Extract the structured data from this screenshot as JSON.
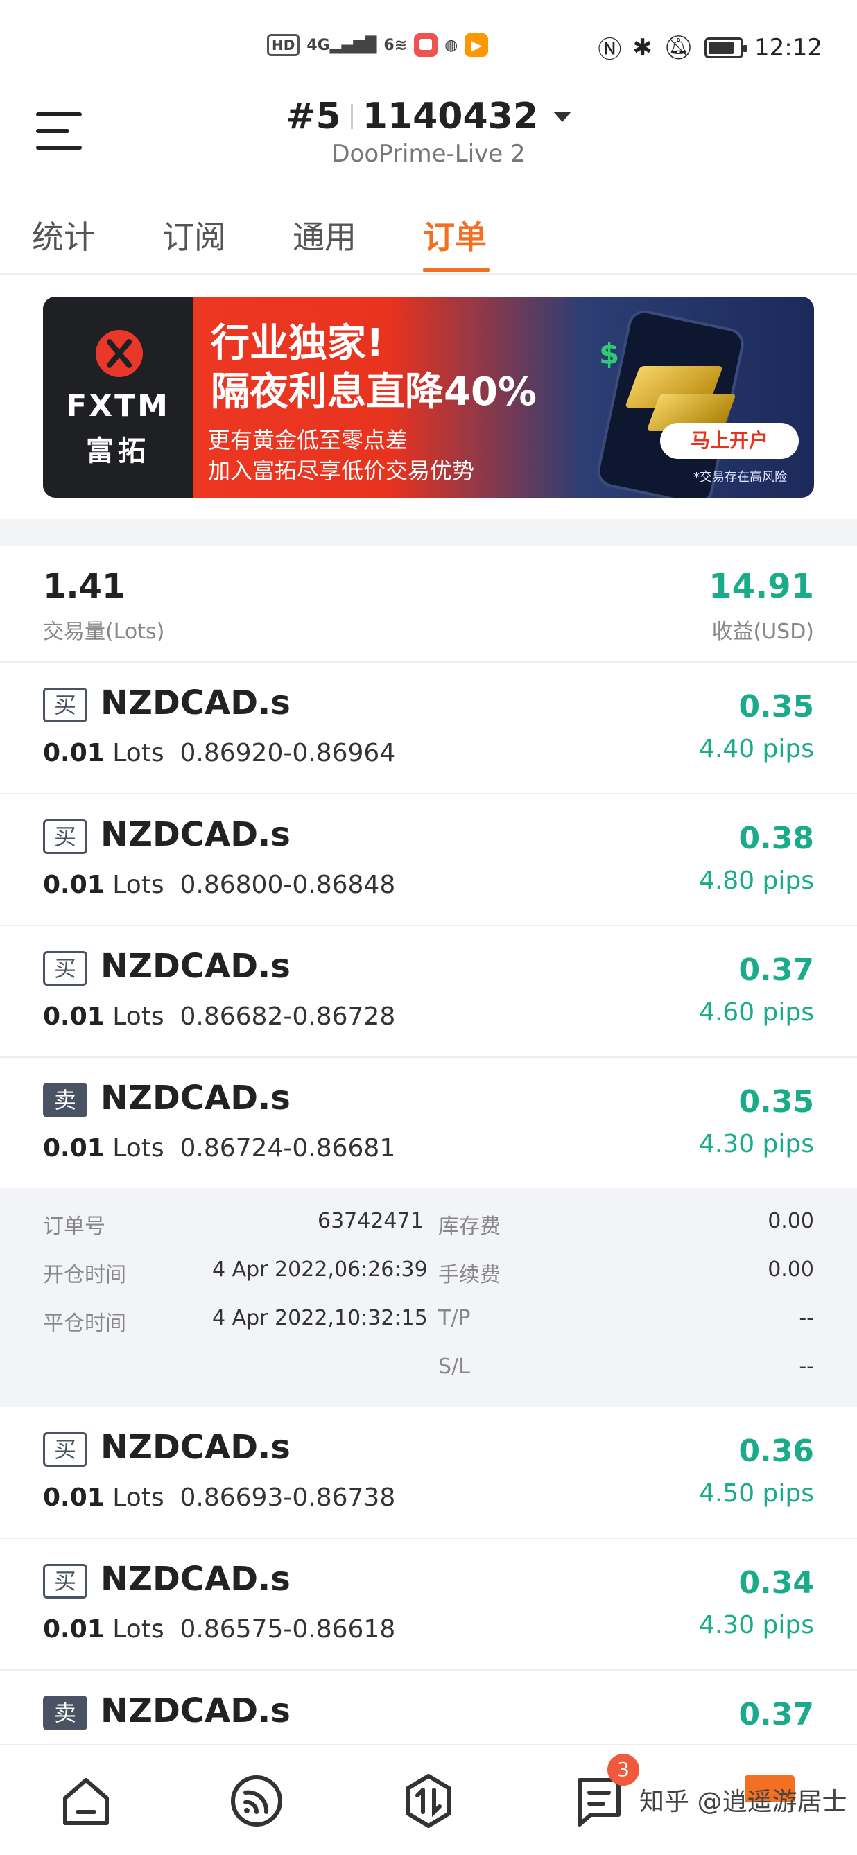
{
  "status_bar": {
    "hd_badge": "HD",
    "signal_4g": "4G",
    "signal_6": "6",
    "time": "12:12"
  },
  "header": {
    "account_prefix": "#5",
    "account_number": "1140432",
    "server": "DooPrime-Live 2"
  },
  "tabs": [
    {
      "label": "统计"
    },
    {
      "label": "订阅"
    },
    {
      "label": "通用"
    },
    {
      "label": "订单",
      "active": true
    }
  ],
  "banner": {
    "brand": "FXTM",
    "brand_cn": "富拓",
    "headline1": "行业独家!",
    "headline2": "隔夜利息直降40%",
    "sub1": "更有黄金低至零点差",
    "sub2": "加入富拓尽享低价交易优势",
    "cta": "马上开户",
    "risk_note": "*交易存在高风险",
    "dollar_glyph": "$"
  },
  "summary": {
    "lots": "1.41",
    "lots_label": "交易量(Lots)",
    "profit": "14.91",
    "profit_label": "收益(USD)"
  },
  "orders": [
    {
      "side": "买",
      "type": "buy",
      "symbol": "NZDCAD.s",
      "lots": "0.01",
      "lots_unit": "Lots",
      "range": "0.86920-0.86964",
      "profit": "0.35",
      "pips": "4.40 pips"
    },
    {
      "side": "买",
      "type": "buy",
      "symbol": "NZDCAD.s",
      "lots": "0.01",
      "lots_unit": "Lots",
      "range": "0.86800-0.86848",
      "profit": "0.38",
      "pips": "4.80 pips"
    },
    {
      "side": "买",
      "type": "buy",
      "symbol": "NZDCAD.s",
      "lots": "0.01",
      "lots_unit": "Lots",
      "range": "0.86682-0.86728",
      "profit": "0.37",
      "pips": "4.60 pips"
    },
    {
      "side": "卖",
      "type": "sell",
      "symbol": "NZDCAD.s",
      "lots": "0.01",
      "lots_unit": "Lots",
      "range": "0.86724-0.86681",
      "profit": "0.35",
      "pips": "4.30 pips"
    },
    {
      "side": "买",
      "type": "buy",
      "symbol": "NZDCAD.s",
      "lots": "0.01",
      "lots_unit": "Lots",
      "range": "0.86693-0.86738",
      "profit": "0.36",
      "pips": "4.50 pips"
    },
    {
      "side": "买",
      "type": "buy",
      "symbol": "NZDCAD.s",
      "lots": "0.01",
      "lots_unit": "Lots",
      "range": "0.86575-0.86618",
      "profit": "0.34",
      "pips": "4.30 pips"
    },
    {
      "side": "卖",
      "type": "sell",
      "symbol": "NZDCAD.s",
      "profit": "0.37"
    }
  ],
  "detail": {
    "order_no_label": "订单号",
    "order_no": "63742471",
    "open_time_label": "开仓时间",
    "open_time": "4 Apr 2022,06:26:39",
    "close_time_label": "平仓时间",
    "close_time": "4 Apr 2022,10:32:15",
    "swap_label": "库存费",
    "swap": "0.00",
    "commission_label": "手续费",
    "commission": "0.00",
    "tp_label": "T/P",
    "tp": "--",
    "sl_label": "S/L",
    "sl": "--"
  },
  "bottom_nav": {
    "items": [
      "home-icon",
      "signal-icon",
      "trade-icon",
      "orders-icon",
      "profile-icon"
    ],
    "badge_count": "3",
    "watermark": "知乎 @逍遥游居士"
  },
  "colors": {
    "accent": "#f36f21",
    "profit_green": "#1aab8a"
  }
}
